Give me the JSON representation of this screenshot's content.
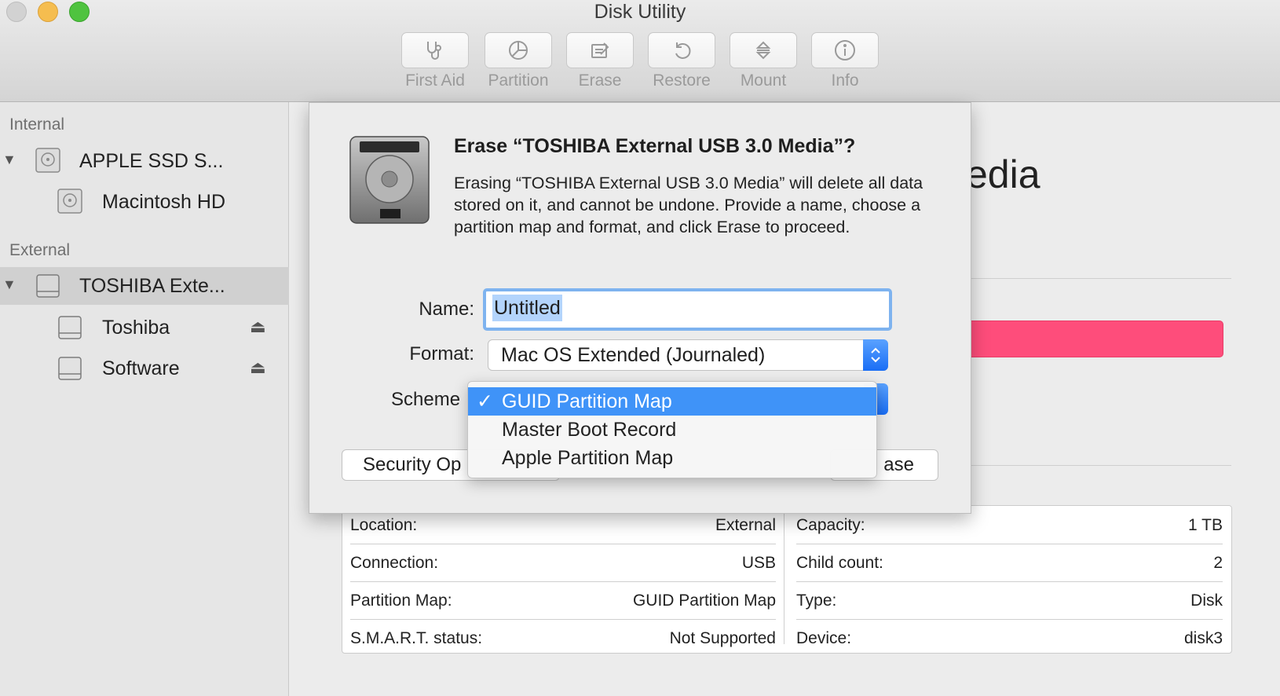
{
  "window": {
    "title": "Disk Utility"
  },
  "toolbar": {
    "items": [
      {
        "label": "First Aid",
        "icon": "stethoscope-icon"
      },
      {
        "label": "Partition",
        "icon": "pie-icon"
      },
      {
        "label": "Erase",
        "icon": "eraser-icon"
      },
      {
        "label": "Restore",
        "icon": "restore-icon"
      },
      {
        "label": "Mount",
        "icon": "mount-icon"
      },
      {
        "label": "Info",
        "icon": "info-icon"
      }
    ]
  },
  "sidebar": {
    "internal_label": "Internal",
    "external_label": "External",
    "items": [
      {
        "label": "APPLE SSD S..."
      },
      {
        "label": "Macintosh HD"
      },
      {
        "label": "TOSHIBA Exte..."
      },
      {
        "label": "Toshiba"
      },
      {
        "label": "Software"
      }
    ],
    "disclosure": "▼",
    "eject_glyph": "⏏"
  },
  "main": {
    "title_fragment": "edia",
    "usage_color": "#fe4d7b"
  },
  "sheet": {
    "title": "Erase “TOSHIBA External USB 3.0 Media”?",
    "message": "Erasing “TOSHIBA External USB 3.0 Media” will delete all data stored on it, and cannot be undone. Provide a name, choose a partition map and format, and click Erase to proceed.",
    "name_label": "Name:",
    "name_value": "Untitled",
    "format_label": "Format:",
    "format_value": "Mac OS Extended (Journaled)",
    "scheme_label": "Scheme",
    "security_button": "Security Op",
    "erase_button_fragment": "ase"
  },
  "scheme_menu": {
    "check": "✓",
    "options": [
      "GUID Partition Map",
      "Master Boot Record",
      "Apple Partition Map"
    ],
    "selected_index": 0
  },
  "info": {
    "left": [
      {
        "label": "Location:",
        "value": "External"
      },
      {
        "label": "Connection:",
        "value": "USB"
      },
      {
        "label": "Partition Map:",
        "value": "GUID Partition Map"
      },
      {
        "label": "S.M.A.R.T. status:",
        "value": "Not Supported"
      }
    ],
    "right": [
      {
        "label": "Capacity:",
        "value": "1 TB"
      },
      {
        "label": "Child count:",
        "value": "2"
      },
      {
        "label": "Type:",
        "value": "Disk"
      },
      {
        "label": "Device:",
        "value": "disk3"
      }
    ]
  }
}
